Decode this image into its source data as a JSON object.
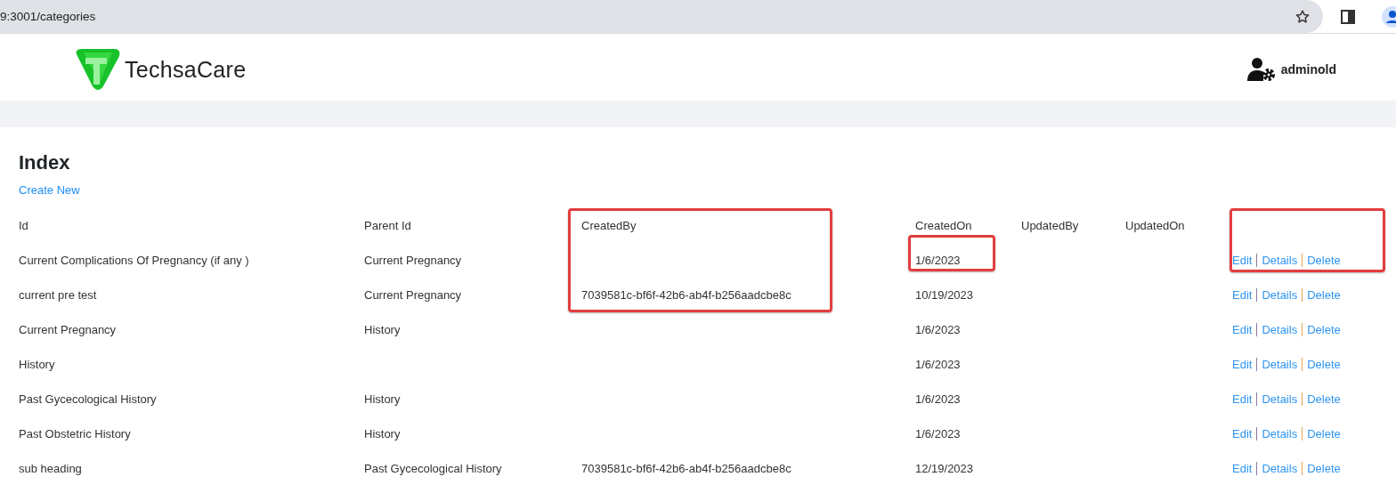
{
  "browser": {
    "url": "9:3001/categories"
  },
  "navbar": {
    "brand": "TechsaCare",
    "user": "adminold"
  },
  "page": {
    "title": "Index",
    "create_link": "Create New"
  },
  "table": {
    "columns": [
      {
        "label": "Id"
      },
      {
        "label": "Parent Id"
      },
      {
        "label": "CreatedBy",
        "highlighted": true
      },
      {
        "label": "CreatedOn"
      },
      {
        "label": "UpdatedBy"
      },
      {
        "label": "UpdatedOn"
      },
      {
        "highlighted": true
      }
    ],
    "rows": [
      {
        "cells": [
          "Current Complications Of Pregnancy (if any )",
          "Current Pregnancy",
          {
            "highlighted": true
          },
          {
            "text": "1/6/2023",
            "highlighted": true
          },
          null,
          null
        ],
        "actions": [
          "Edit",
          "Details",
          "Delete"
        ],
        "actions_highlighted": true
      },
      {
        "cells": [
          "current pre test",
          "Current Pregnancy",
          {
            "text": "7039581c-bf6f-42b6-ab4f-b256aadcbe8c",
            "highlighted": true
          },
          "10/19/2023",
          null,
          null
        ],
        "actions": [
          "Edit",
          "Details",
          "Delete"
        ]
      },
      {
        "cells": [
          "Current Pregnancy",
          "History",
          null,
          "1/6/2023",
          null,
          null
        ],
        "actions": [
          "Edit",
          "Details",
          "Delete"
        ]
      },
      {
        "cells": [
          "History",
          null,
          null,
          "1/6/2023",
          null,
          null
        ],
        "actions": [
          "Edit",
          "Details",
          "Delete"
        ]
      },
      {
        "cells": [
          "Past Gycecological History",
          "History",
          null,
          "1/6/2023",
          null,
          null
        ],
        "actions": [
          "Edit",
          "Details",
          "Delete"
        ]
      },
      {
        "cells": [
          "Past Obstetric History",
          "History",
          null,
          "1/6/2023",
          null,
          null
        ],
        "actions": [
          "Edit",
          "Details",
          "Delete"
        ]
      },
      {
        "cells": [
          "sub heading",
          "Past Gycecological History",
          "7039581c-bf6f-42b6-ab4f-b256aadcbe8c",
          "12/19/2023",
          null,
          null
        ],
        "actions": [
          "Edit",
          "Details",
          "Delete"
        ]
      }
    ]
  }
}
